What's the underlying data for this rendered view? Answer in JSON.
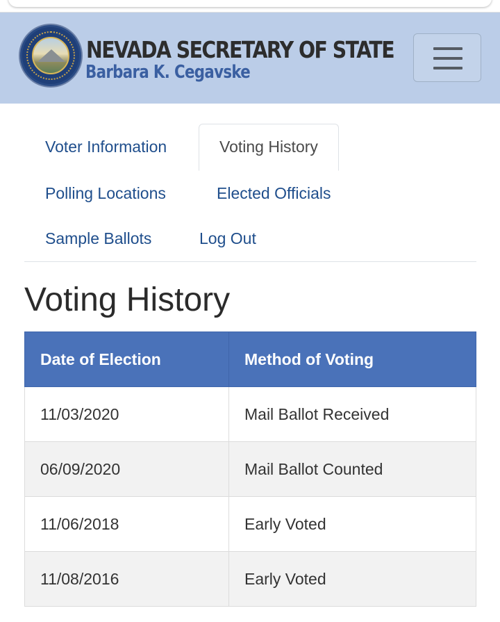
{
  "header": {
    "title": "NEVADA SECRETARY OF STATE",
    "subtitle": "Barbara K. Cegavske",
    "seal_icon": "nevada-state-seal",
    "menu_icon": "hamburger-menu-icon",
    "background_color": "#bbcde8"
  },
  "nav": {
    "tabs": [
      {
        "label": "Voter Information",
        "active": false
      },
      {
        "label": "Voting History",
        "active": true
      },
      {
        "label": "Polling Locations",
        "active": false
      },
      {
        "label": "Elected Officials",
        "active": false
      },
      {
        "label": "Sample Ballots",
        "active": false
      },
      {
        "label": "Log Out",
        "active": false
      }
    ],
    "link_color": "#1f4e8c"
  },
  "main": {
    "page_title": "Voting History",
    "table": {
      "header_color": "#4a72b9",
      "columns": [
        "Date of Election",
        "Method of Voting"
      ],
      "rows": [
        [
          "11/03/2020",
          "Mail Ballot Received"
        ],
        [
          "06/09/2020",
          "Mail Ballot Counted"
        ],
        [
          "11/06/2018",
          "Early Voted"
        ],
        [
          "11/08/2016",
          "Early Voted"
        ]
      ]
    }
  }
}
